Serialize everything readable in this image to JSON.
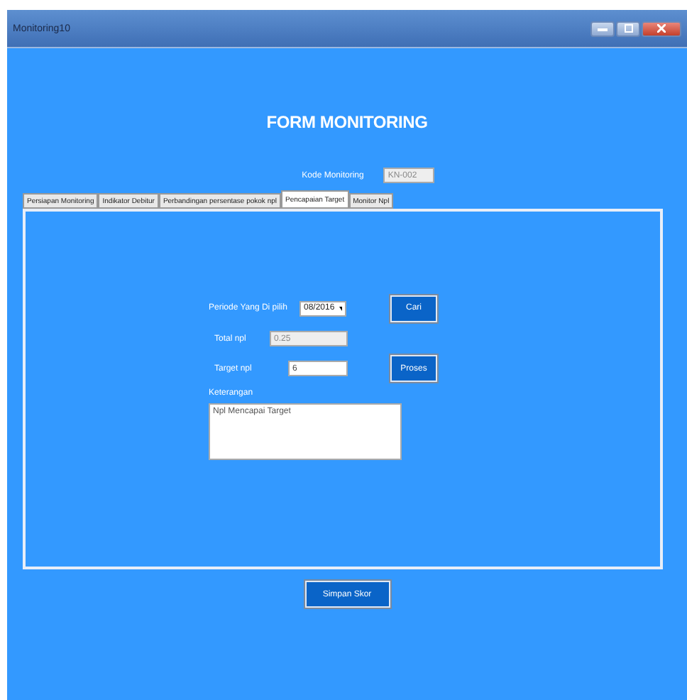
{
  "window": {
    "title": "Monitoring10"
  },
  "heading": "FORM MONITORING",
  "kode": {
    "label": "Kode Monitoring",
    "value": "KN-002"
  },
  "tabs": [
    {
      "label": "Persiapan Monitoring",
      "selected": false
    },
    {
      "label": "Indikator Debitur",
      "selected": false
    },
    {
      "label": "Perbandingan persentase pokok npl",
      "selected": false
    },
    {
      "label": "Pencapaian Target",
      "selected": true
    },
    {
      "label": "Monitor Npl",
      "selected": false
    }
  ],
  "periode": {
    "label": "Periode Yang Di pilih",
    "value": "08/2016",
    "button": "Cari"
  },
  "total": {
    "label": "Total npl",
    "value": "0.25"
  },
  "target": {
    "label": "Target npl",
    "value": "6",
    "button": "Proses"
  },
  "keterangan": {
    "label": "Keterangan",
    "value": "Npl Mencapai Target"
  },
  "save_button": "Simpan Skor"
}
